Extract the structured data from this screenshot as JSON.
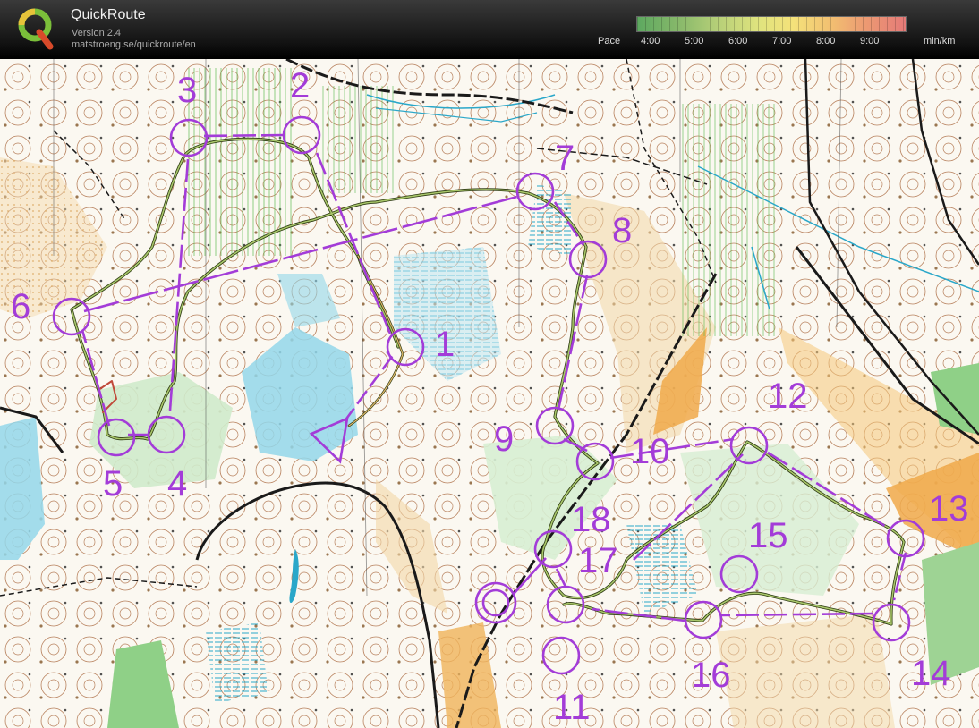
{
  "app": {
    "title": "QuickRoute",
    "version": "Version 2.4",
    "url": "matstroeng.se/quickroute/en"
  },
  "pace_legend": {
    "label": "Pace",
    "ticks": [
      "4:00",
      "5:00",
      "6:00",
      "7:00",
      "8:00",
      "9:00"
    ],
    "unit": "min/km",
    "colors": [
      "#5da860",
      "#b6cf78",
      "#f4e27a",
      "#e57a78"
    ]
  },
  "map": {
    "overprint_color": "#a33cd8",
    "route_color": "#6e8a3a",
    "control_labels": [
      "1",
      "2",
      "3",
      "4",
      "5",
      "6",
      "7",
      "8",
      "9",
      "10",
      "11",
      "12",
      "13",
      "14",
      "15",
      "16",
      "17",
      "18"
    ]
  }
}
